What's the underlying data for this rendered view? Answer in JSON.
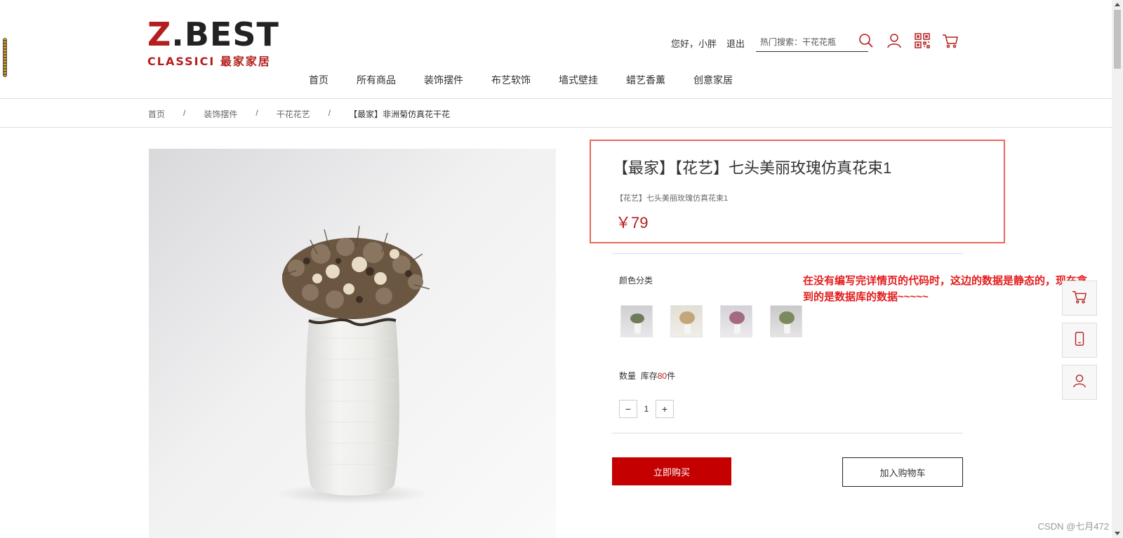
{
  "header": {
    "logo": {
      "main_red": "Z",
      "main_rest": ".BEST",
      "sub": "CLASSICI 最家家居"
    },
    "greeting": "您好，小胖",
    "logout_label": "退出",
    "search_placeholder": "热门搜索：干花花瓶",
    "icons": [
      "search-icon",
      "user-icon",
      "qr-code-icon",
      "cart-icon"
    ]
  },
  "nav": {
    "items": [
      "首页",
      "所有商品",
      "装饰摆件",
      "布艺软饰",
      "墙式壁挂",
      "蜡艺香薰",
      "创意家居"
    ]
  },
  "breadcrumb": {
    "items": [
      "首页",
      "装饰摆件",
      "干花花艺"
    ],
    "separator": "/",
    "current": "【最家】非洲菊仿真花干花"
  },
  "product": {
    "title": "【最家】【花艺】七头美丽玫瑰仿真花束1",
    "subtitle": "【花艺】七头美丽玫瑰仿真花束1",
    "price": "￥79",
    "color_label": "颜色分类",
    "thumbnail_count": 4,
    "quantity_label": "数量",
    "stock_prefix": "库存",
    "stock_count": "80",
    "stock_suffix": "件",
    "quantity_value": "1",
    "minus_label": "−",
    "plus_label": "+",
    "buy_now_label": "立即购买",
    "add_to_cart_label": "加入购物车"
  },
  "annotation": "在没有编写完详情页的代码时，这边的数据是静态的，现在拿到的是数据库的数据~~~~~",
  "side_bar": {
    "icons": [
      "cart-icon",
      "phone-icon",
      "user-icon"
    ]
  },
  "watermark": "CSDN @七月472",
  "colors": {
    "brand_red": "#c40000",
    "highlight_border": "#e8695a",
    "annotation_red": "#e51c1c"
  }
}
